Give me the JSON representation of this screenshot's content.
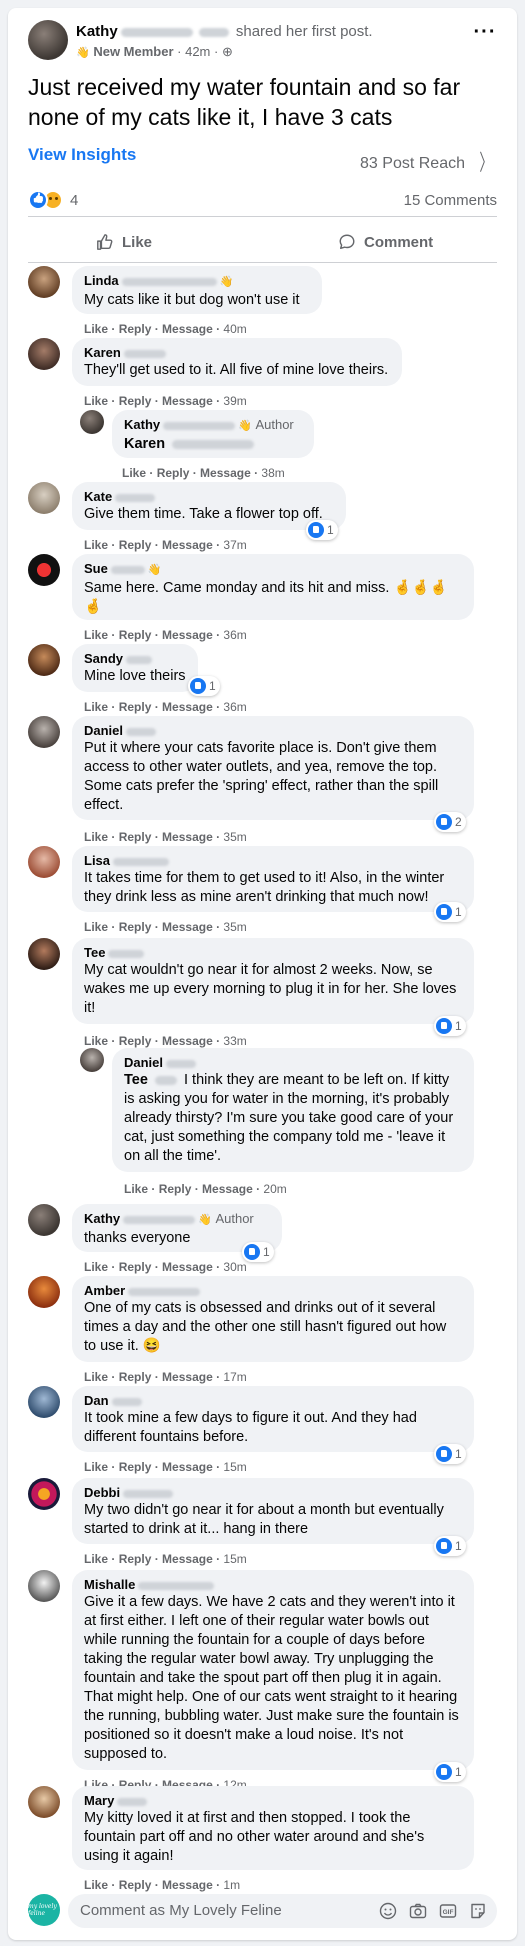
{
  "post": {
    "author": "Kathy",
    "shared": "shared her first post.",
    "badge": "New Member",
    "time": "42m",
    "text": "Just received my water fountain and so far none of my cats like it, I have 3 cats",
    "view_insights": "View Insights",
    "reach": "83 Post Reach",
    "reaction_count": "4",
    "comment_count": "15 Comments",
    "like_label": "Like",
    "comment_label": "Comment"
  },
  "actions": {
    "like": "Like",
    "reply": "Reply",
    "message": "Message"
  },
  "comments": [
    {
      "name": "Linda",
      "text": "My cats like it but dog won't use it",
      "time": "40m"
    },
    {
      "name": "Karen",
      "text": "They'll get used to it. All five of mine love theirs.",
      "time": "39m"
    },
    {
      "name": "Kathy",
      "author": "Author",
      "mention": "Karen",
      "text": "",
      "time": "38m"
    },
    {
      "name": "Kate",
      "text": "Give them time. Take a flower top off.",
      "time": "37m",
      "reactions": "1"
    },
    {
      "name": "Sue",
      "text": "Same here. Came monday and its hit and miss. 🤞🤞🤞 🤞",
      "time": "36m"
    },
    {
      "name": "Sandy",
      "text": "Mine love theirs",
      "time": "36m",
      "reactions": "1"
    },
    {
      "name": "Daniel",
      "text": "Put it where your cats favorite place is. Don't give them access to other water outlets, and yea, remove the top. Some cats prefer the 'spring' effect, rather than the spill effect.",
      "time": "35m",
      "reactions": "2"
    },
    {
      "name": "Lisa",
      "text": "It takes time for them to get used to it! Also, in the winter they drink less as mine aren't drinking that much now!",
      "time": "35m",
      "reactions": "1"
    },
    {
      "name": "Tee",
      "text": "My cat wouldn't go near it for almost 2 weeks. Now, se wakes me up every morning to plug it in for her. She loves it!",
      "time": "33m",
      "reactions": "1"
    },
    {
      "name": "Daniel",
      "mention": "Tee",
      "text": "I think they are meant to be left on. If kitty is asking you for water in the morning, it's probably already thirsty? I'm sure you take good care of your cat, just something the company told me - 'leave it on all the time'.",
      "time": "20m"
    },
    {
      "name": "Kathy",
      "author": "Author",
      "text": "thanks everyone",
      "time": "30m",
      "reactions": "1"
    },
    {
      "name": "Amber",
      "text": "One of my cats is obsessed and drinks out of it several times a day and the other one still hasn't figured out how to use it. 😆",
      "time": "17m"
    },
    {
      "name": "Dan",
      "text": "It took mine a few days to figure it out. And they had different fountains before.",
      "time": "15m",
      "reactions": "1"
    },
    {
      "name": "Debbi",
      "text": "My two didn't go near it for about a month but eventually started to drink at it... hang in there",
      "time": "15m",
      "reactions": "1"
    },
    {
      "name": "Mishalle",
      "text": "Give it a few days. We have 2 cats and they weren't into it at first either. I left one of their regular water bowls out while running the fountain for a couple of days before taking the regular water bowl away. Try unplugging the fountain and take the spout part off then plug it in again. That might help. One of our cats went straight to it hearing the running, bubbling water. Just make sure the fountain is positioned so it doesn't make a loud noise. It's not supposed to.",
      "time": "12m",
      "reactions": "1"
    },
    {
      "name": "Mary",
      "text": "My kitty loved it at first and then stopped. I took the fountain part off and no other water around and she's using it again!",
      "time": "1m"
    }
  ],
  "compose": {
    "placeholder": "Comment as My Lovely Feline",
    "avatar_text": "my lovely feline"
  },
  "colors": {
    "accent": "#1877f2",
    "bubble": "#f0f2f5",
    "muted": "#65676b"
  }
}
